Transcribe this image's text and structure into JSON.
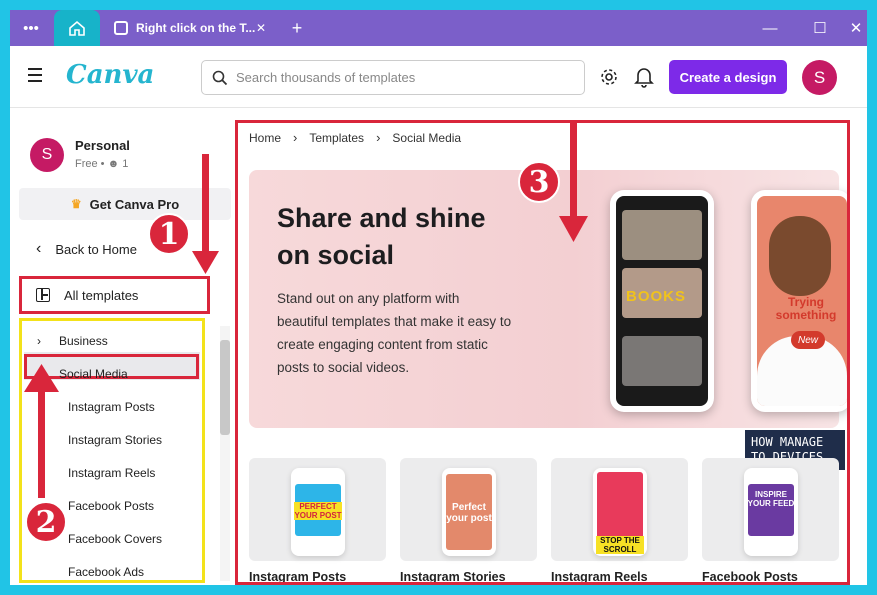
{
  "tab": {
    "title": "Right click on the T..."
  },
  "header": {
    "logo": "Canva",
    "search_placeholder": "Search thousands of templates",
    "create_label": "Create a design",
    "avatar_initial": "S"
  },
  "sidebar": {
    "account_initial": "S",
    "account_name": "Personal",
    "account_plan": "Free •",
    "account_members": "1",
    "get_pro": "Get Canva Pro",
    "back": "Back to Home",
    "all_templates": "All templates",
    "categories": [
      {
        "label": "Business",
        "expanded": false
      },
      {
        "label": "Social Media",
        "expanded": true
      }
    ],
    "sub_items": [
      "Instagram Posts",
      "Instagram Stories",
      "Instagram Reels",
      "Facebook Posts",
      "Facebook Covers",
      "Facebook Ads"
    ]
  },
  "main": {
    "breadcrumb": [
      "Home",
      "Templates",
      "Social Media"
    ],
    "hero": {
      "title": "Share and shine on social",
      "description": "Stand out on any platform with beautiful templates that make it easy to create engaging content from static posts to  social videos.",
      "phone1_text": "BOOKS",
      "phone2_text": "Trying something",
      "phone2_pill": "New"
    },
    "cards": [
      {
        "label": "Instagram Posts",
        "art_text": "PERFECT YOUR POST"
      },
      {
        "label": "Instagram Stories",
        "art_text": "Perfect your post"
      },
      {
        "label": "Instagram Reels",
        "art_text": "STOP THE SCROLL"
      },
      {
        "label": "Facebook Posts",
        "art_text": "INSPIRE YOUR FEED"
      }
    ]
  },
  "annotations": {
    "one": "1",
    "two": "2",
    "three": "3"
  },
  "watermark": {
    "line1": "HOW MANAGE",
    "line2": "TO DEVICES"
  },
  "colors": {
    "accent": "#7d2ae8",
    "annotation_red": "#d9263b",
    "highlight_yellow": "#f3e21a",
    "frame_cyan": "#21c4e6"
  }
}
